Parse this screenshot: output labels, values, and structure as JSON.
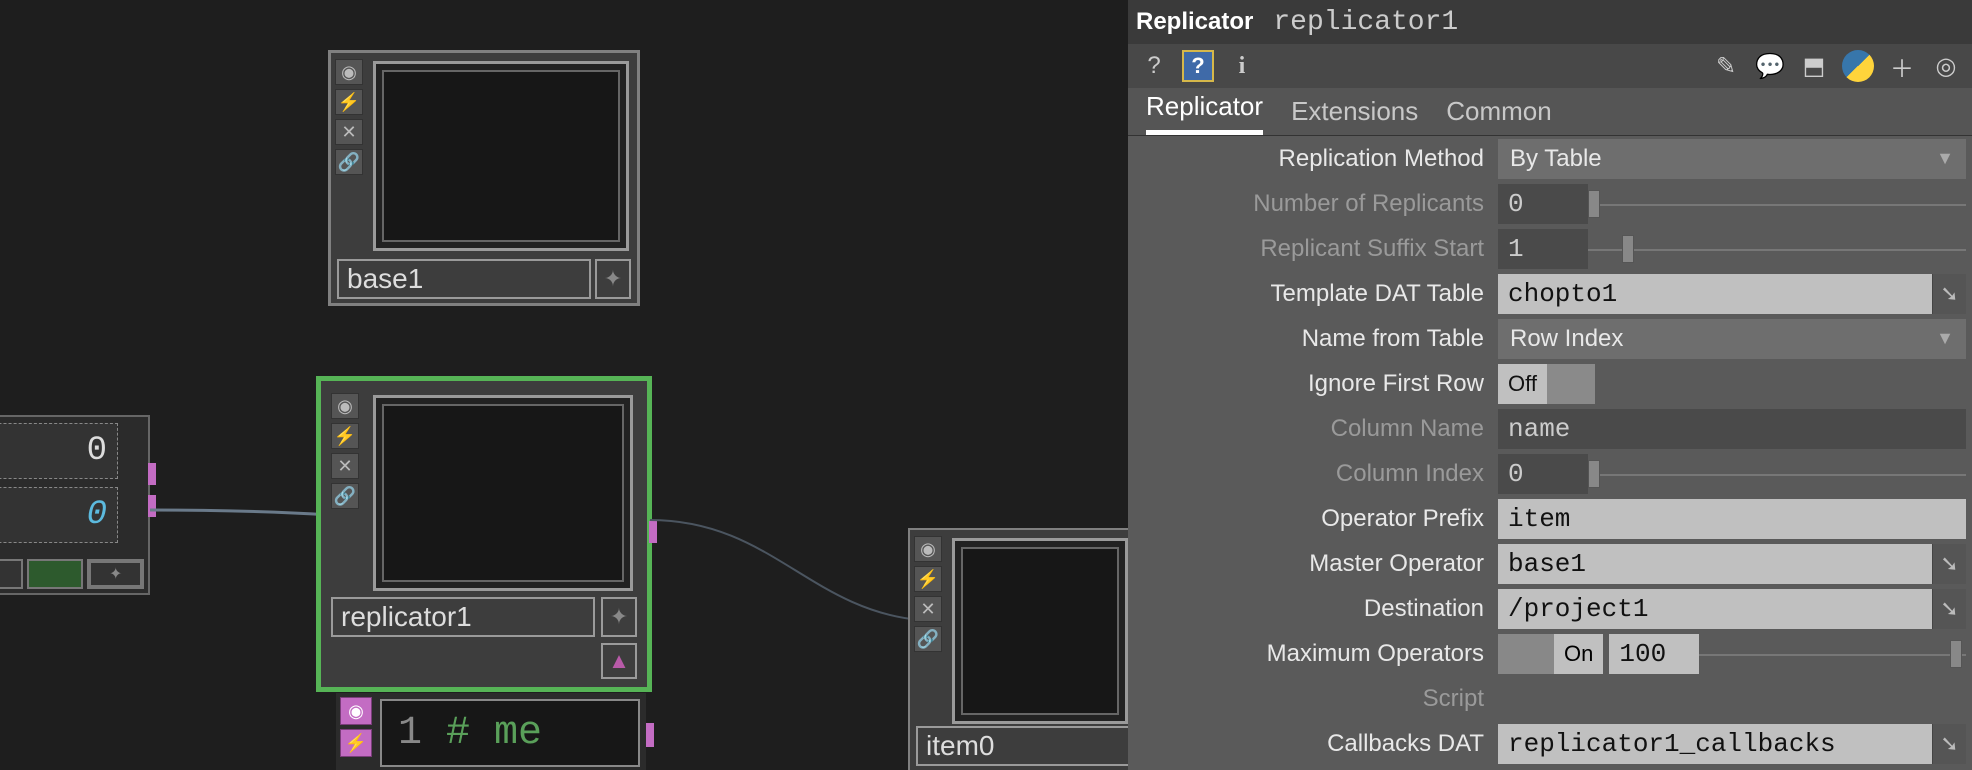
{
  "operator": {
    "type": "Replicator",
    "name": "replicator1"
  },
  "tabs": {
    "t0": "Replicator",
    "t1": "Extensions",
    "t2": "Common"
  },
  "params": {
    "replication_method": {
      "label": "Replication Method",
      "value": "By Table"
    },
    "num_replicants": {
      "label": "Number of Replicants",
      "value": "0"
    },
    "suffix_start": {
      "label": "Replicant Suffix Start",
      "value": "1"
    },
    "template_dat": {
      "label": "Template DAT Table",
      "value": "chopto1"
    },
    "name_from_table": {
      "label": "Name from Table",
      "value": "Row Index"
    },
    "ignore_first": {
      "label": "Ignore First Row",
      "value": "Off"
    },
    "column_name": {
      "label": "Column Name",
      "value": "name"
    },
    "column_index": {
      "label": "Column Index",
      "value": "0"
    },
    "op_prefix": {
      "label": "Operator Prefix",
      "value": "item"
    },
    "master_op": {
      "label": "Master Operator",
      "value": "base1"
    },
    "destination": {
      "label": "Destination",
      "value": "/project1"
    },
    "max_ops": {
      "label": "Maximum Operators",
      "toggle": "On",
      "value": "100"
    },
    "script": {
      "label": "Script"
    },
    "callbacks_dat": {
      "label": "Callbacks DAT",
      "value": "replicator1_callbacks"
    }
  },
  "nodes": {
    "base1": "base1",
    "replicator1": "replicator1",
    "item0": "item0",
    "chop_v0": "0",
    "chop_v1": "0",
    "dat_line": "1",
    "dat_code": "# me"
  }
}
